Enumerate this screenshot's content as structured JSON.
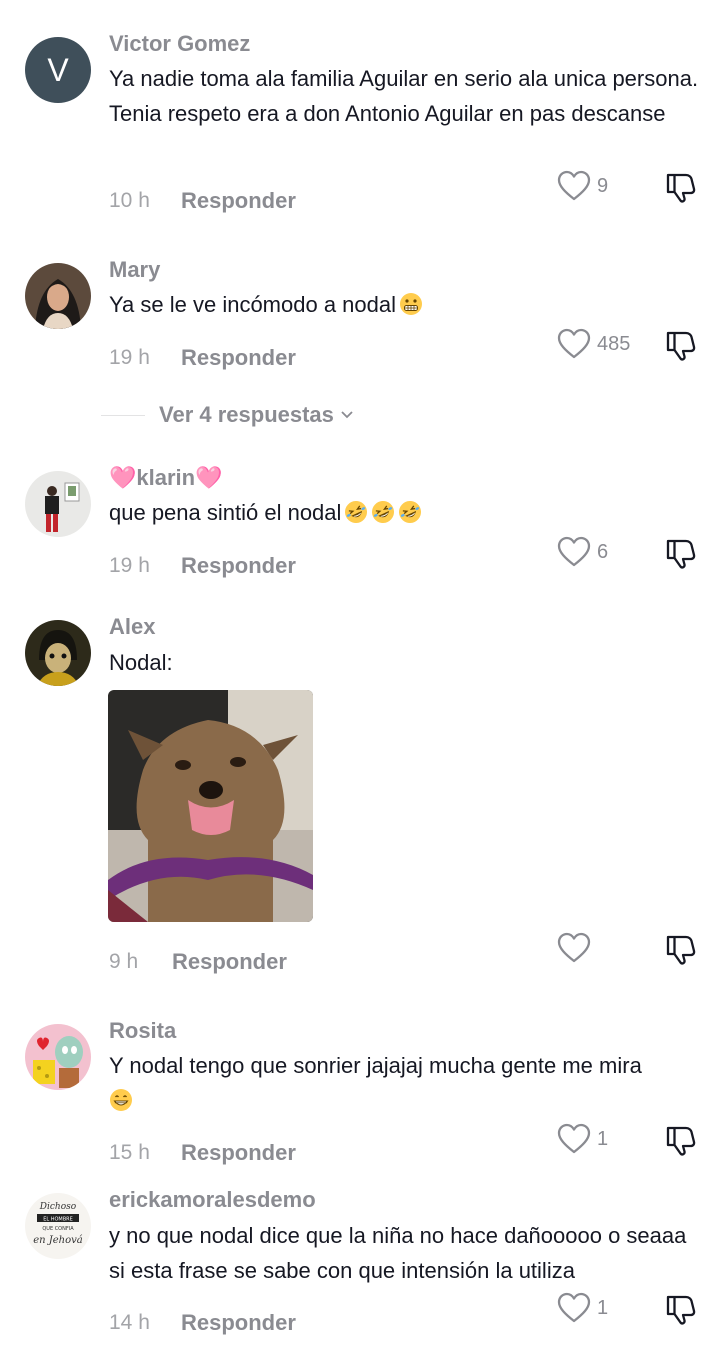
{
  "comments": [
    {
      "username": "Victor Gomez",
      "avatar_letter": "V",
      "text": "Ya nadie toma ala familia Aguilar en serio ala unica persona. Tenia respeto era a don Antonio Aguilar en pas descanse",
      "time": "10 h",
      "reply_label": "Responder",
      "likes": "9"
    },
    {
      "username": "Mary",
      "text": "Ya se le ve incómodo a nodal",
      "emoji": "grimacing-face",
      "time": "19 h",
      "reply_label": "Responder",
      "likes": "485"
    },
    {
      "username": "🩷klarin🩷",
      "text": "que pena sintió el nodal",
      "emoji": "rolling-laughing-face x3",
      "time": "19 h",
      "reply_label": "Responder",
      "likes": "6"
    },
    {
      "username": "Alex",
      "text": "Nodal:",
      "time": "9 h",
      "reply_label": "Responder",
      "likes": ""
    },
    {
      "username": "Rosita",
      "text": "Y nodal tengo que sonrier jajajaj mucha gente me mira",
      "emoji": "grinning-face",
      "time": "15 h",
      "reply_label": "Responder",
      "likes": "1"
    },
    {
      "username": "erickamoralesdemo",
      "text": "y no que nodal dice que la niña no hace dañooooo o seaaa si esta frase se sabe con que intensión la utiliza",
      "time": "14 h",
      "reply_label": "Responder",
      "likes": "1"
    }
  ],
  "view_replies": "Ver 4 respuestas",
  "avatar_6_text": [
    "Dichoso",
    "EL HOMBRE",
    "QUE CONFIA",
    "en Jehová"
  ],
  "colors": {
    "text": "#161823",
    "secondary": "#8a8b91",
    "time": "#a3a4a8"
  }
}
